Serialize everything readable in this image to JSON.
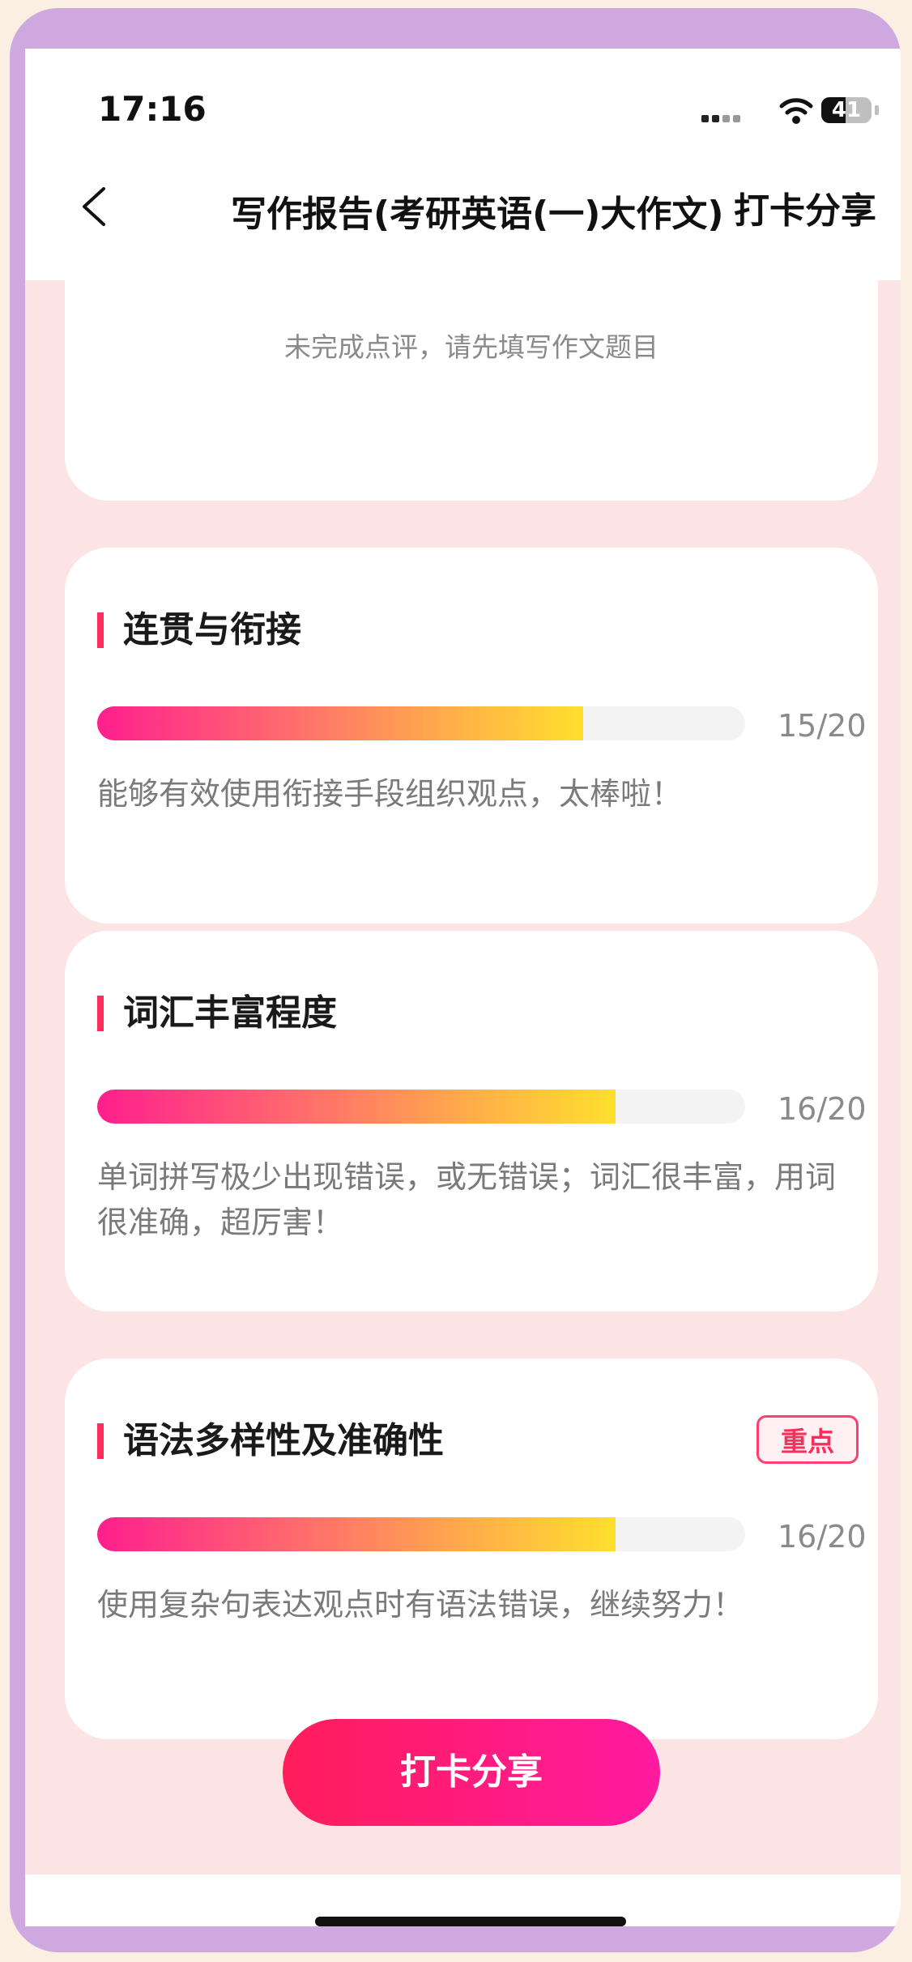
{
  "status": {
    "time": "17:16",
    "battery": "41"
  },
  "nav": {
    "title": "写作报告(考研英语(一)大作文)",
    "share": "打卡分享"
  },
  "empty_message": "未完成点评，请先填写作文题目",
  "sections": [
    {
      "title": "连贯与衔接",
      "score": "15/20",
      "progress": 0.75,
      "desc": "能够有效使用衔接手段组织观点，太棒啦！"
    },
    {
      "title": "词汇丰富程度",
      "score": "16/20",
      "progress": 0.8,
      "desc": "单词拼写极少出现错误，或无错误；词汇很丰富，用词很准确，超厉害！"
    },
    {
      "title": "语法多样性及准确性",
      "score": "16/20",
      "progress": 0.8,
      "desc": "使用复杂句表达观点时有语法错误，继续努力！",
      "badge": "重点"
    }
  ],
  "cta": "打卡分享"
}
